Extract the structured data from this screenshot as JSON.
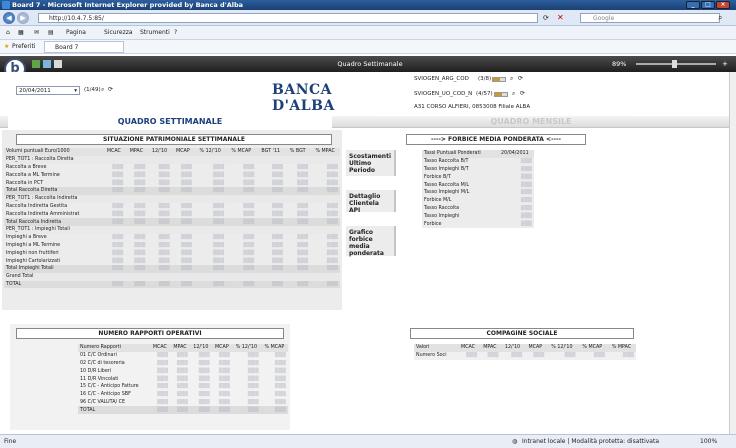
{
  "window": {
    "title": "Board 7 - Microsoft Internet Explorer provided by Banca d'Alba"
  },
  "browser": {
    "url": "http://10.4.7.5:85/",
    "search_placeholder": "Google",
    "menu": {
      "page": "Pagina",
      "security": "Sicurezza",
      "tools": "Strumenti"
    },
    "favorites_label": "Preferiti",
    "tab_label": "Board 7"
  },
  "app": {
    "title": "Quadro Settimanale",
    "zoom": "89%"
  },
  "filters": {
    "date": "20/04/2011",
    "pager": "(1/49)",
    "arg_code": "SVIOGEN_ARG_COD",
    "arg_count": "(3/8)",
    "uo_code": "SVIOGEN_UO_COD_N",
    "uo_count": "(4/57)",
    "branch": "A31 CORSO ALFIERI, 0853008 Filiale ALBA"
  },
  "tabs": {
    "weekly": "QUADRO SETTIMANALE",
    "monthly": "QUADRO MENSILE"
  },
  "situazione": {
    "title": "SITUAZIONE PATRIMONIALE SETTIMANALE",
    "headers": [
      "Volumi puntuali Euro/1000",
      "MCAC",
      "MPAC",
      "12/'10",
      "MCAP",
      "% 12/'10",
      "% MCAP",
      "BGT '11",
      "% BGT",
      "% MPAC"
    ],
    "rows": [
      {
        "label": "PER_TOT1 : Raccolta Diretta",
        "type": "grp"
      },
      {
        "label": "Raccolta a Breve",
        "type": "row"
      },
      {
        "label": "Raccolta a ML Termine",
        "type": "row"
      },
      {
        "label": "Raccolta in PCT",
        "type": "row"
      },
      {
        "label": "Total Raccolta Diretta",
        "type": "tot"
      },
      {
        "label": "PER_TOT1 : Raccolta Indiretta",
        "type": "grp"
      },
      {
        "label": "Raccolta Indiretta Gestita",
        "type": "row"
      },
      {
        "label": "Raccolta Indiretta Amministrat",
        "type": "row"
      },
      {
        "label": "Total Raccolta Indiretta",
        "type": "tot"
      },
      {
        "label": "PER_TOT1 : Impieghi Totali",
        "type": "grp"
      },
      {
        "label": "Impieghi a Breve",
        "type": "row"
      },
      {
        "label": "Impieghi a ML Termine",
        "type": "row"
      },
      {
        "label": "Impieghi non fruttiferi",
        "type": "row"
      },
      {
        "label": "Impieghi Cartolarizzati",
        "type": "row"
      },
      {
        "label": "Total Impieghi Totali",
        "type": "tot"
      },
      {
        "label": "Grand Total",
        "type": "grp"
      },
      {
        "label": "TOTAL",
        "type": "tot"
      }
    ]
  },
  "side_buttons": [
    "Scostamenti Ultimo Periodo",
    "Dettaglio Clientela API",
    "Grafico forbice media ponderata"
  ],
  "forbice": {
    "title": "----> FORBICE MEDIA PONDERATA <----",
    "headers": [
      "Tassi Puntuali Ponderati",
      "20/04/2011"
    ],
    "rows": [
      "Tasso Raccolta B/T",
      "Tasso Impieghi B/T",
      "Forbice B/T",
      "Tasso Raccolta M/L",
      "Tasso Impieghi M/L",
      "Forbice M/L",
      "Tasso Raccolta",
      "Tasso Impieghi",
      "Forbice"
    ]
  },
  "rapporti": {
    "title": "NUMERO RAPPORTI OPERATIVI",
    "headers": [
      "Numero Rapporti",
      "MCAC",
      "MPAC",
      "12/'10",
      "MCAP",
      "% 12/'10",
      "% MCAP"
    ],
    "rows": [
      "01 C/C Ordinari",
      "02 C/C di tesoreria",
      "10 D/R Liberi",
      "11 D/R Vincolati",
      "15 C/C - Anticipo Fatture",
      "16 C/C - Anticipo SBF",
      "96 C/C VALUTA/ CE",
      "TOTAL"
    ]
  },
  "compagine": {
    "title": "COMPAGINE SOCIALE",
    "headers": [
      "Valori",
      "MCAC",
      "MPAC",
      "12/'10",
      "MCAP",
      "% 12/'10",
      "% MCAP",
      "% MPAC"
    ],
    "rows": [
      "Numero Soci"
    ]
  },
  "status": {
    "left": "Fine",
    "zone": "Intranet locale | Modalità protetta: disattivata",
    "zoom": "100%"
  }
}
